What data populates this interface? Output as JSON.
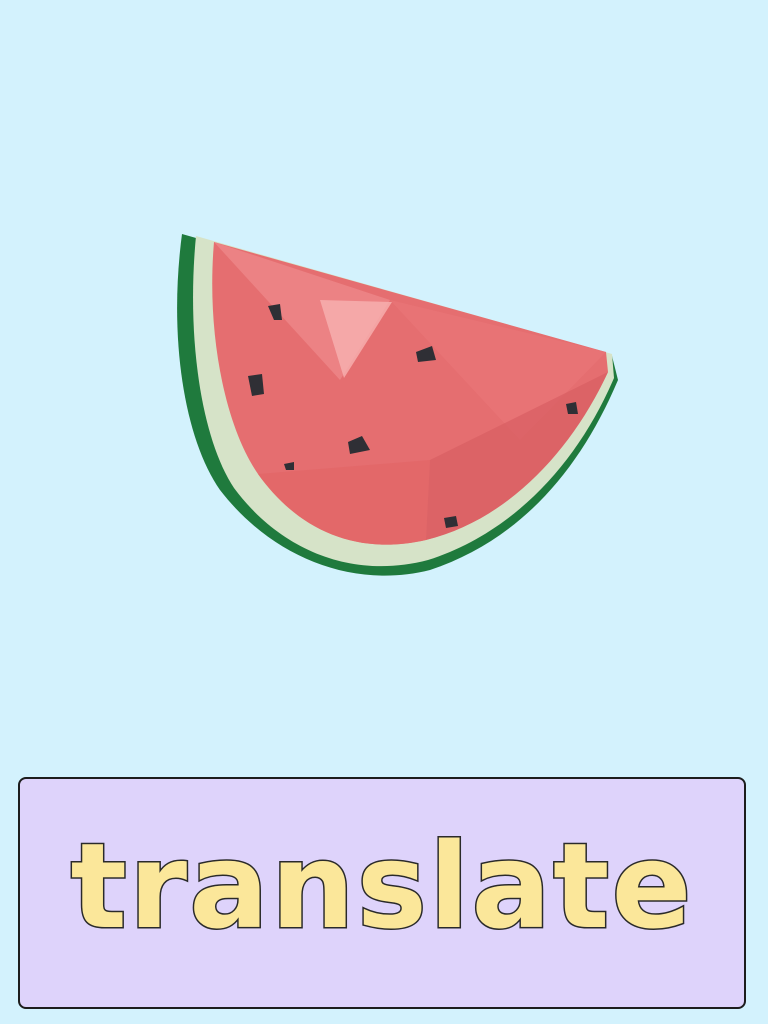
{
  "card": {
    "image_icon": "watermelon-slice-icon",
    "word": "translate"
  },
  "colors": {
    "background": "#d3f2fd",
    "word_box": "#ded3fb",
    "word_text": "#fbe79a",
    "outline": "#1d1d1d",
    "rind": "#1f7a3d",
    "pith": "#d6e3c8",
    "flesh": "#e56e70",
    "seed": "#2f2f35"
  }
}
